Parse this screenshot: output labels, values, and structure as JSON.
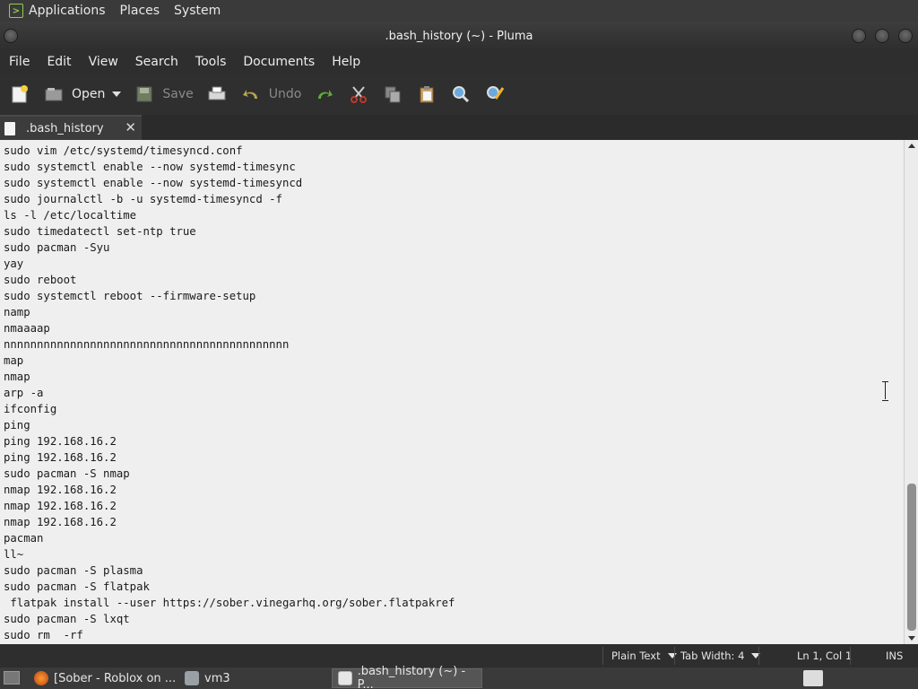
{
  "top_panel": {
    "menus": [
      "Applications",
      "Places",
      "System"
    ]
  },
  "window": {
    "title": ".bash_history (~) - Pluma"
  },
  "menubar": {
    "items": [
      "File",
      "Edit",
      "View",
      "Search",
      "Tools",
      "Documents",
      "Help"
    ]
  },
  "toolbar": {
    "new_icon": "new-document-icon",
    "open_label": "Open",
    "save_label": "Save",
    "undo_label": "Undo"
  },
  "tab": {
    "label": ".bash_history",
    "close": "✕"
  },
  "editor": {
    "lines": [
      "sudo vim /etc/systemd/timesyncd.conf",
      "sudo systemctl enable --now systemd-timesync",
      "sudo systemctl enable --now systemd-timesyncd",
      "sudo journalctl -b -u systemd-timesyncd -f",
      "ls -l /etc/localtime",
      "sudo timedatectl set-ntp true",
      "sudo pacman -Syu",
      "yay",
      "sudo reboot",
      "sudo systemctl reboot --firmware-setup",
      "namp",
      "nmaaaap",
      "nnnnnnnnnnnnnnnnnnnnnnnnnnnnnnnnnnnnnnnnnnn",
      "map",
      "nmap",
      "arp -a",
      "ifconfig",
      "ping",
      "ping 192.168.16.2",
      "ping 192.168.16.2",
      "sudo pacman -S nmap",
      "nmap 192.168.16.2",
      "nmap 192.168.16.2",
      "nmap 192.168.16.2",
      "pacman",
      "ll~",
      "sudo pacman -S plasma",
      "sudo pacman -S flatpak",
      " flatpak install --user https://sober.vinegarhq.org/sober.flatpakref",
      "sudo pacman -S lxqt",
      "sudo rm  -rf"
    ]
  },
  "statusbar": {
    "language": "Plain Text",
    "tab_width": "Tab Width: 4",
    "position": "Ln 1, Col 1",
    "mode": "INS"
  },
  "taskbar": {
    "tasks": [
      "[Sober - Roblox on ...",
      "vm3",
      ".bash_history (~) - P..."
    ]
  }
}
